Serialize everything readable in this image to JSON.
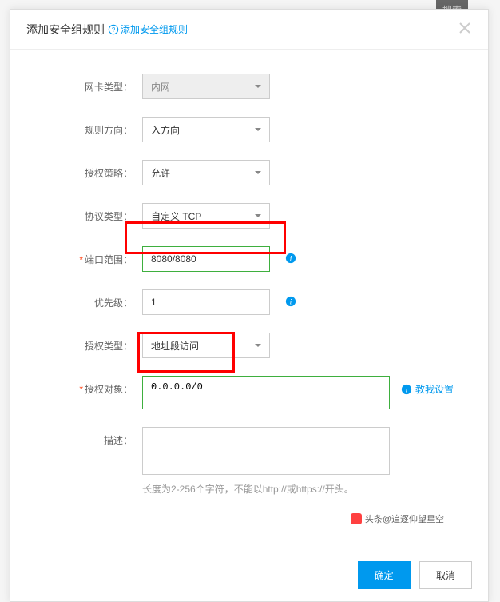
{
  "bg": {
    "search": "搜索"
  },
  "modal": {
    "title": "添加安全组规则",
    "helpText": "添加安全组规则"
  },
  "form": {
    "nicType": {
      "label": "网卡类型：",
      "value": "内网"
    },
    "direction": {
      "label": "规则方向：",
      "value": "入方向"
    },
    "policy": {
      "label": "授权策略：",
      "value": "允许"
    },
    "protocol": {
      "label": "协议类型：",
      "value": "自定义 TCP"
    },
    "portRange": {
      "label": "端口范围：",
      "value": "8080/8080"
    },
    "priority": {
      "label": "优先级：",
      "value": "1"
    },
    "authType": {
      "label": "授权类型：",
      "value": "地址段访问"
    },
    "authObj": {
      "label": "授权对象：",
      "value": "0.0.0.0/0",
      "teach": "教我设置"
    },
    "desc": {
      "label": "描述：",
      "hint": "长度为2-256个字符，不能以http://或https://开头。"
    }
  },
  "footer": {
    "ok": "确定",
    "cancel": "取消"
  },
  "watermark": "头条@追逐仰望星空"
}
